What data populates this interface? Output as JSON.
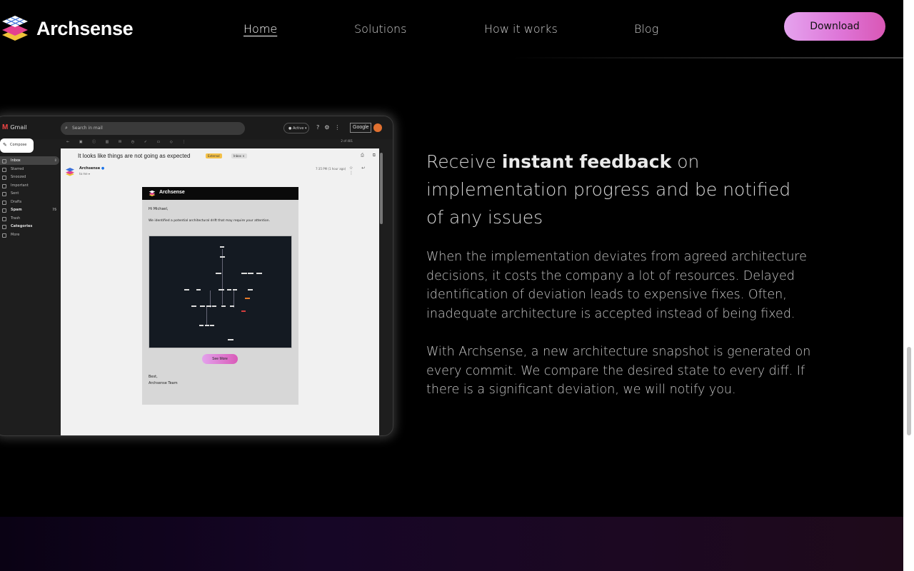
{
  "header": {
    "brand": "Archsense",
    "nav": [
      "Home",
      "Solutions",
      "How it works",
      "Blog"
    ],
    "download_label": "Download"
  },
  "gmail": {
    "app_name": "Gmail",
    "search_placeholder": "Search in mail",
    "status": "Active",
    "google_label": "Google",
    "compose_label": "Compose",
    "sidebar": [
      {
        "label": "Inbox",
        "count": "8"
      },
      {
        "label": "Starred",
        "count": ""
      },
      {
        "label": "Snoozed",
        "count": ""
      },
      {
        "label": "Important",
        "count": ""
      },
      {
        "label": "Sent",
        "count": ""
      },
      {
        "label": "Drafts",
        "count": ""
      },
      {
        "label": "Spam",
        "count": "75"
      },
      {
        "label": "Trash",
        "count": ""
      },
      {
        "label": "Categories",
        "count": ""
      },
      {
        "label": "More",
        "count": ""
      }
    ],
    "pager": "2 of 401",
    "subject": "It looks like things are not going as expected",
    "badge_external": "External",
    "badge_inbox": "Inbox ×",
    "sender": "Archsense",
    "to": "to me ▾",
    "time": "7:35 PM (1 hour ago)",
    "email": {
      "brand": "Archsense",
      "greeting": "Hi Michael,",
      "body": "We identified a potential architectural drift that may require your attention.",
      "cta": "See More",
      "sign_1": "Best,",
      "sign_2": "Archsense Team"
    }
  },
  "feature": {
    "headline_pre": "Receive ",
    "headline_bold": "instant feedback",
    "headline_post": " on implementation progress and be notified of any issues",
    "paragraph_1": "When the implementation deviates from agreed architecture decisions, it costs the company a lot of resources. Delayed identification of deviation leads to expensive fixes. Often, inadequate architecture is accepted instead of being fixed.",
    "paragraph_2": "With Archsense, a new architecture snapshot is generated on every commit. We compare the desired state to every diff. If there is a significant deviation, we will notify you."
  },
  "colors": {
    "background": "#000000",
    "button_gradient_start": "#e5a3ee",
    "button_gradient_end": "#d957b5",
    "alert_orange": "#e67a2a",
    "alert_red": "#d43d3d"
  }
}
